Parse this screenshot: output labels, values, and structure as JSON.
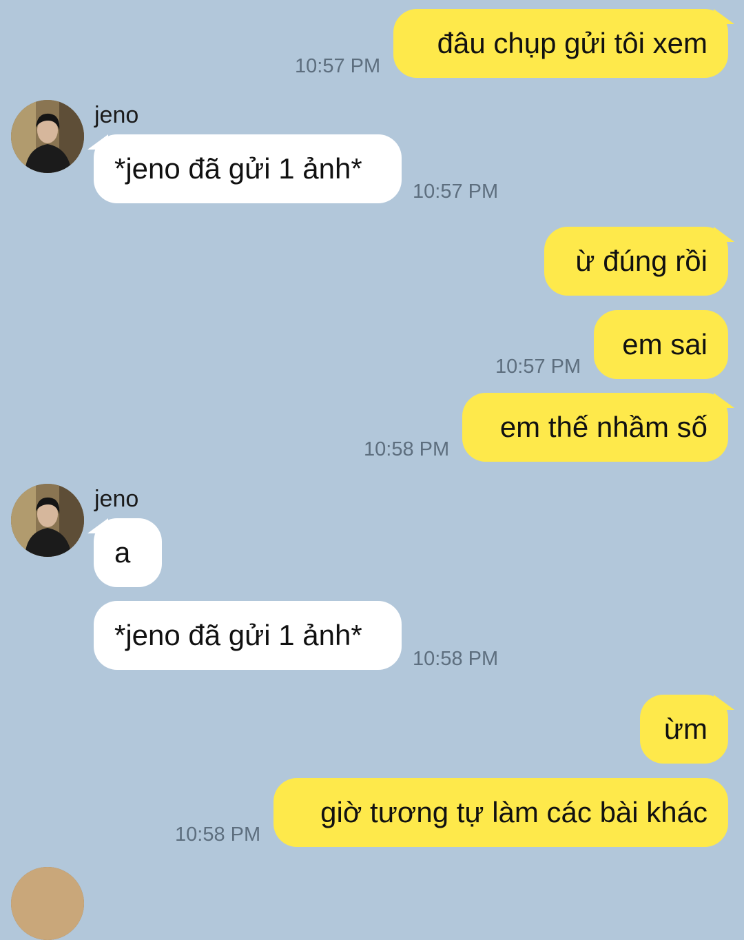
{
  "contact": {
    "name": "jeno"
  },
  "messages": [
    {
      "side": "out",
      "text": "đâu chụp gửi tôi xem",
      "time": "10:57 PM"
    },
    {
      "side": "in",
      "text": "*jeno đã gửi 1 ảnh*",
      "time": "10:57 PM"
    },
    {
      "side": "out",
      "text": "ừ đúng rồi",
      "time": ""
    },
    {
      "side": "out",
      "text": "em sai",
      "time": "10:57 PM"
    },
    {
      "side": "out",
      "text": "em thế nhầm số",
      "time": "10:58 PM"
    },
    {
      "side": "in",
      "text": "a",
      "time": ""
    },
    {
      "side": "in",
      "text": "*jeno đã gửi 1 ảnh*",
      "time": "10:58 PM"
    },
    {
      "side": "out",
      "text": "ừm",
      "time": ""
    },
    {
      "side": "out",
      "text": "giờ tương tự làm các bài khác",
      "time": "10:58 PM"
    }
  ],
  "colors": {
    "background": "#b2c7da",
    "outgoing_bubble": "#fee94b",
    "incoming_bubble": "#ffffff",
    "timestamp": "#5d6e7e"
  },
  "icons": {
    "avatar": "profile-photo"
  }
}
